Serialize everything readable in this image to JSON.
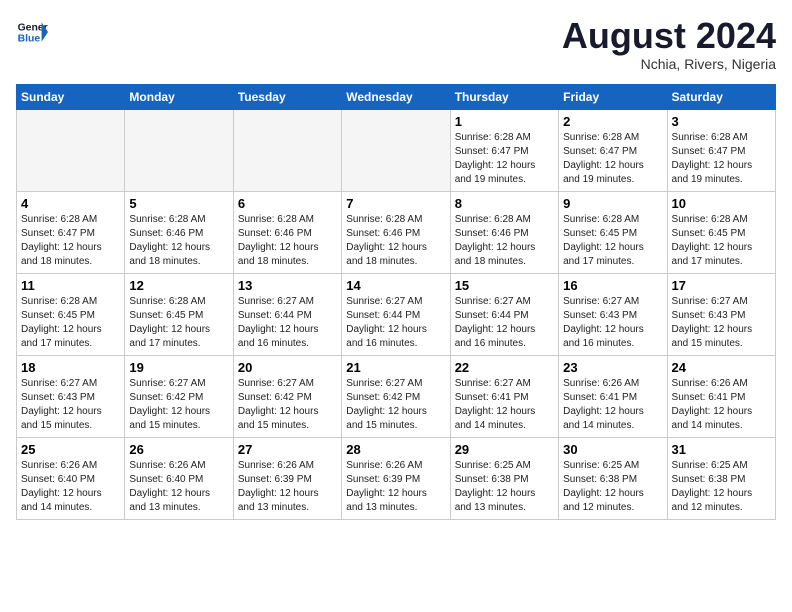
{
  "header": {
    "logo_line1": "General",
    "logo_line2": "Blue",
    "month_year": "August 2024",
    "location": "Nchia, Rivers, Nigeria"
  },
  "weekdays": [
    "Sunday",
    "Monday",
    "Tuesday",
    "Wednesday",
    "Thursday",
    "Friday",
    "Saturday"
  ],
  "weeks": [
    [
      {
        "day": "",
        "info": ""
      },
      {
        "day": "",
        "info": ""
      },
      {
        "day": "",
        "info": ""
      },
      {
        "day": "",
        "info": ""
      },
      {
        "day": "1",
        "info": "Sunrise: 6:28 AM\nSunset: 6:47 PM\nDaylight: 12 hours\nand 19 minutes."
      },
      {
        "day": "2",
        "info": "Sunrise: 6:28 AM\nSunset: 6:47 PM\nDaylight: 12 hours\nand 19 minutes."
      },
      {
        "day": "3",
        "info": "Sunrise: 6:28 AM\nSunset: 6:47 PM\nDaylight: 12 hours\nand 19 minutes."
      }
    ],
    [
      {
        "day": "4",
        "info": "Sunrise: 6:28 AM\nSunset: 6:47 PM\nDaylight: 12 hours\nand 18 minutes."
      },
      {
        "day": "5",
        "info": "Sunrise: 6:28 AM\nSunset: 6:46 PM\nDaylight: 12 hours\nand 18 minutes."
      },
      {
        "day": "6",
        "info": "Sunrise: 6:28 AM\nSunset: 6:46 PM\nDaylight: 12 hours\nand 18 minutes."
      },
      {
        "day": "7",
        "info": "Sunrise: 6:28 AM\nSunset: 6:46 PM\nDaylight: 12 hours\nand 18 minutes."
      },
      {
        "day": "8",
        "info": "Sunrise: 6:28 AM\nSunset: 6:46 PM\nDaylight: 12 hours\nand 18 minutes."
      },
      {
        "day": "9",
        "info": "Sunrise: 6:28 AM\nSunset: 6:45 PM\nDaylight: 12 hours\nand 17 minutes."
      },
      {
        "day": "10",
        "info": "Sunrise: 6:28 AM\nSunset: 6:45 PM\nDaylight: 12 hours\nand 17 minutes."
      }
    ],
    [
      {
        "day": "11",
        "info": "Sunrise: 6:28 AM\nSunset: 6:45 PM\nDaylight: 12 hours\nand 17 minutes."
      },
      {
        "day": "12",
        "info": "Sunrise: 6:28 AM\nSunset: 6:45 PM\nDaylight: 12 hours\nand 17 minutes."
      },
      {
        "day": "13",
        "info": "Sunrise: 6:27 AM\nSunset: 6:44 PM\nDaylight: 12 hours\nand 16 minutes."
      },
      {
        "day": "14",
        "info": "Sunrise: 6:27 AM\nSunset: 6:44 PM\nDaylight: 12 hours\nand 16 minutes."
      },
      {
        "day": "15",
        "info": "Sunrise: 6:27 AM\nSunset: 6:44 PM\nDaylight: 12 hours\nand 16 minutes."
      },
      {
        "day": "16",
        "info": "Sunrise: 6:27 AM\nSunset: 6:43 PM\nDaylight: 12 hours\nand 16 minutes."
      },
      {
        "day": "17",
        "info": "Sunrise: 6:27 AM\nSunset: 6:43 PM\nDaylight: 12 hours\nand 15 minutes."
      }
    ],
    [
      {
        "day": "18",
        "info": "Sunrise: 6:27 AM\nSunset: 6:43 PM\nDaylight: 12 hours\nand 15 minutes."
      },
      {
        "day": "19",
        "info": "Sunrise: 6:27 AM\nSunset: 6:42 PM\nDaylight: 12 hours\nand 15 minutes."
      },
      {
        "day": "20",
        "info": "Sunrise: 6:27 AM\nSunset: 6:42 PM\nDaylight: 12 hours\nand 15 minutes."
      },
      {
        "day": "21",
        "info": "Sunrise: 6:27 AM\nSunset: 6:42 PM\nDaylight: 12 hours\nand 15 minutes."
      },
      {
        "day": "22",
        "info": "Sunrise: 6:27 AM\nSunset: 6:41 PM\nDaylight: 12 hours\nand 14 minutes."
      },
      {
        "day": "23",
        "info": "Sunrise: 6:26 AM\nSunset: 6:41 PM\nDaylight: 12 hours\nand 14 minutes."
      },
      {
        "day": "24",
        "info": "Sunrise: 6:26 AM\nSunset: 6:41 PM\nDaylight: 12 hours\nand 14 minutes."
      }
    ],
    [
      {
        "day": "25",
        "info": "Sunrise: 6:26 AM\nSunset: 6:40 PM\nDaylight: 12 hours\nand 14 minutes."
      },
      {
        "day": "26",
        "info": "Sunrise: 6:26 AM\nSunset: 6:40 PM\nDaylight: 12 hours\nand 13 minutes."
      },
      {
        "day": "27",
        "info": "Sunrise: 6:26 AM\nSunset: 6:39 PM\nDaylight: 12 hours\nand 13 minutes."
      },
      {
        "day": "28",
        "info": "Sunrise: 6:26 AM\nSunset: 6:39 PM\nDaylight: 12 hours\nand 13 minutes."
      },
      {
        "day": "29",
        "info": "Sunrise: 6:25 AM\nSunset: 6:38 PM\nDaylight: 12 hours\nand 13 minutes."
      },
      {
        "day": "30",
        "info": "Sunrise: 6:25 AM\nSunset: 6:38 PM\nDaylight: 12 hours\nand 12 minutes."
      },
      {
        "day": "31",
        "info": "Sunrise: 6:25 AM\nSunset: 6:38 PM\nDaylight: 12 hours\nand 12 minutes."
      }
    ]
  ]
}
